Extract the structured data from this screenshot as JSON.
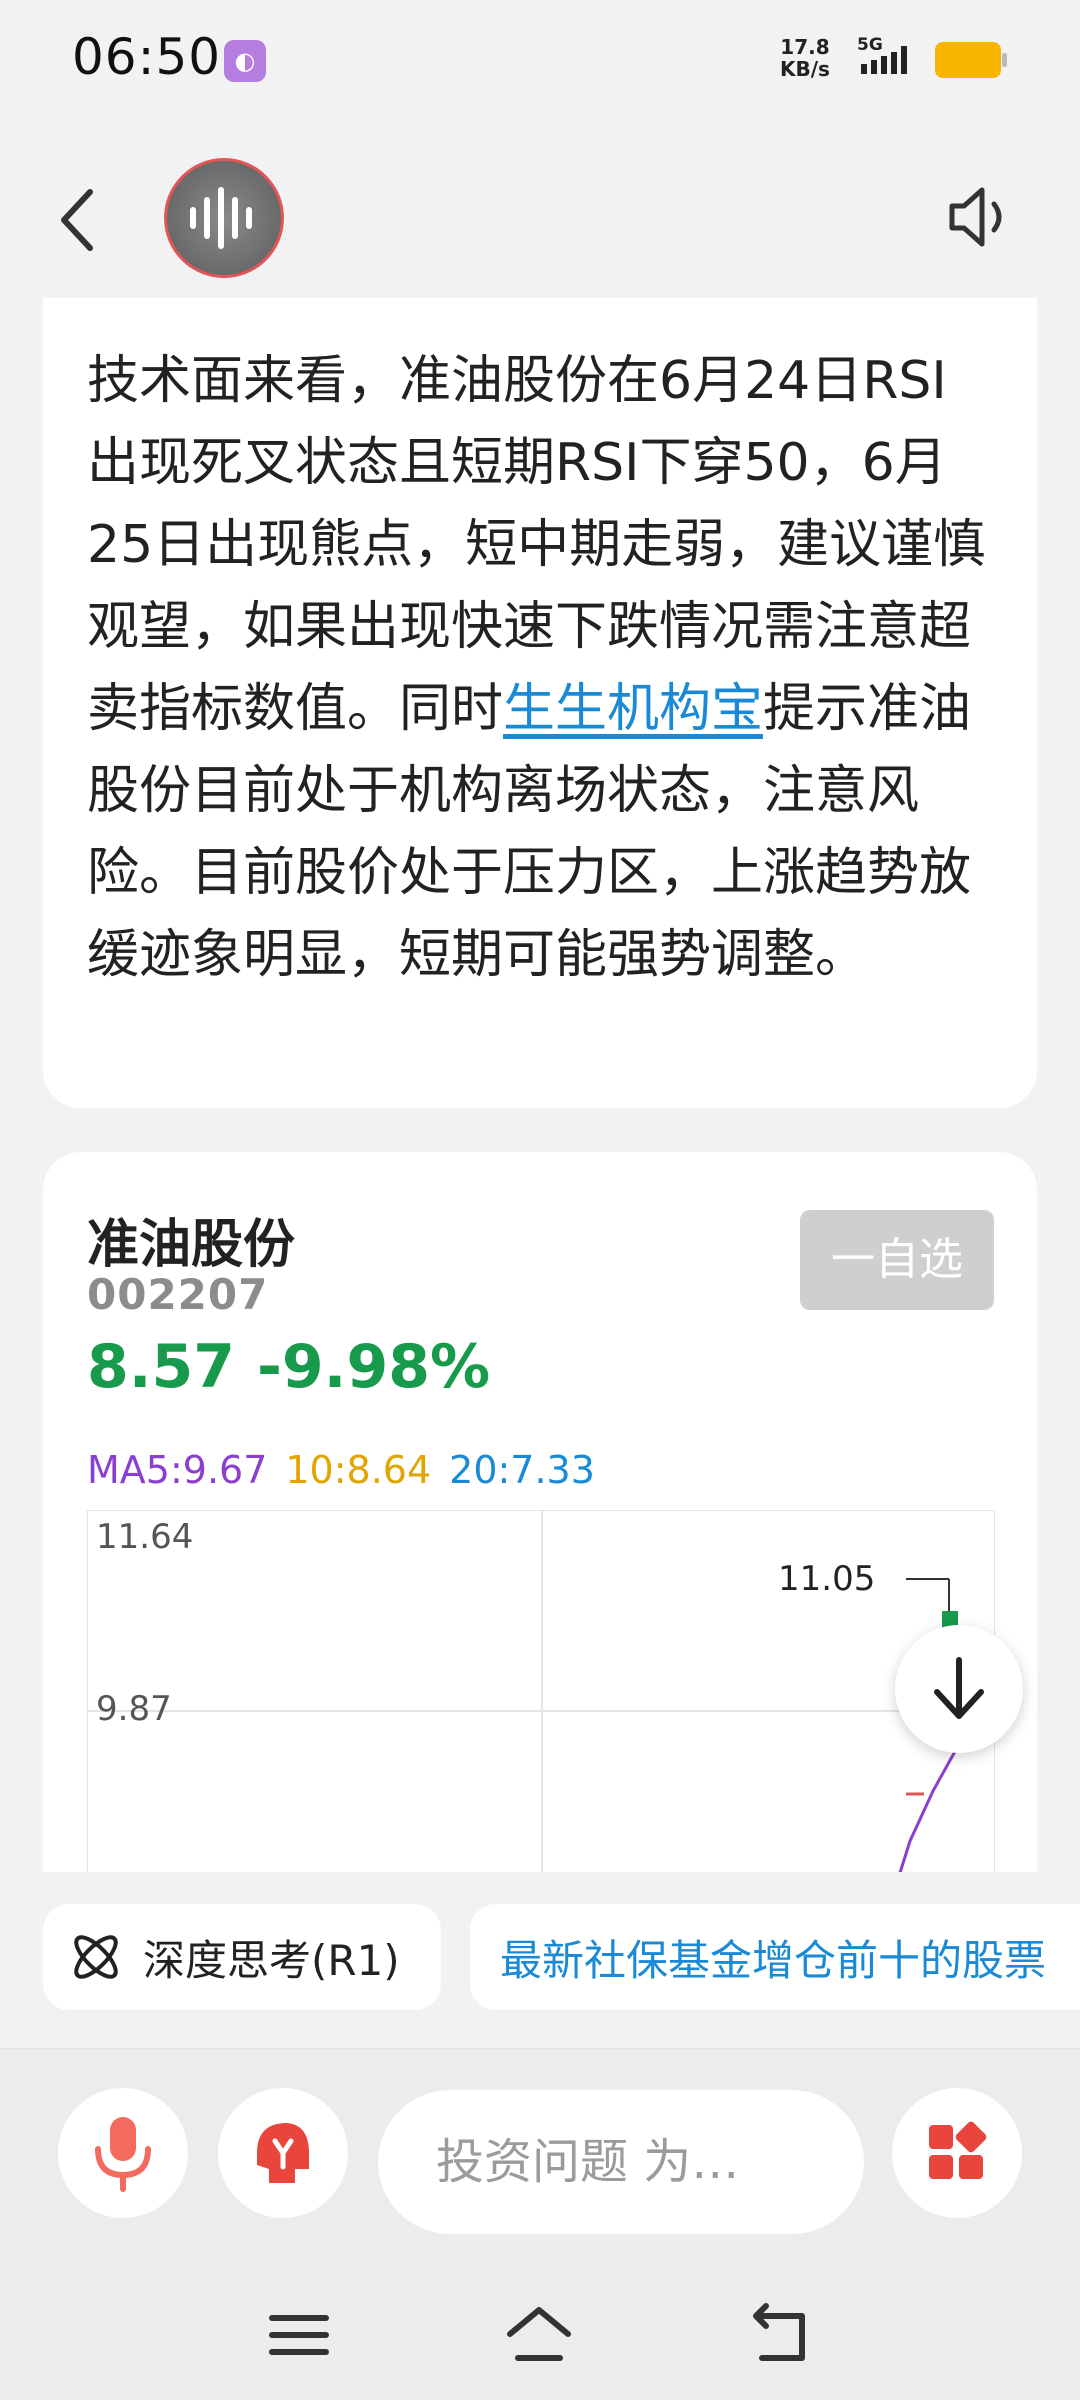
{
  "status_bar": {
    "time": "06:50",
    "net_speed_value": "17.8",
    "net_speed_unit": "KB/s",
    "network": "5G"
  },
  "message": {
    "text_before_link": "技术面来看，准油股份在6月24日RSI出现死叉状态且短期RSI下穿50，6月25日出现熊点，短中期走弱，建议谨慎观望，如果出现快速下跌情况需注意超卖指标数值。同时",
    "link_text": "生生机构宝",
    "text_after_link": "提示准油股份目前处于机构离场状态，注意风险。目前股价处于压力区，上涨趋势放缓迹象明显，短期可能强势调整。"
  },
  "stock": {
    "name": "准油股份",
    "code": "002207",
    "price": "8.57",
    "change": "-9.98%",
    "watch_button": "一自选",
    "ma5": "MA5:9.67",
    "ma10": "10:8.64",
    "ma20": "20:7.33",
    "chart": {
      "y_top_label": "11.64",
      "y_mid_label": "9.87",
      "high_marker": "11.05"
    }
  },
  "chips": {
    "deep_think": "深度思考(R1)",
    "suggestion": "最新社保基金增仓前十的股票"
  },
  "input": {
    "placeholder": "投资问题 为…"
  },
  "colors": {
    "down_green": "#179a4b",
    "link_blue": "#1a8ad6",
    "ma5_purple": "#8a3fd0",
    "ma10_orange": "#e2a400",
    "accent_red": "#e25656"
  }
}
